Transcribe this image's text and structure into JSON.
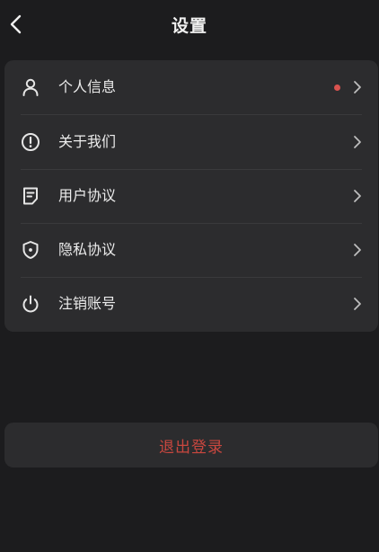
{
  "header": {
    "title": "设置",
    "back_icon": "chevron-left-icon"
  },
  "menu": {
    "items": [
      {
        "label": "个人信息",
        "icon": "user-icon",
        "has_badge_dot": true
      },
      {
        "label": "关于我们",
        "icon": "info-circle-icon",
        "has_badge_dot": false
      },
      {
        "label": "用户协议",
        "icon": "document-icon",
        "has_badge_dot": false
      },
      {
        "label": "隐私协议",
        "icon": "shield-icon",
        "has_badge_dot": false
      },
      {
        "label": "注销账号",
        "icon": "power-icon",
        "has_badge_dot": false
      }
    ]
  },
  "logout": {
    "label": "退出登录"
  },
  "colors": {
    "background": "#1c1c1e",
    "card": "#2c2c2e",
    "text": "#ececec",
    "icon": "#e6e6e6",
    "chevron": "#bdbdbd",
    "badge_dot": "#d9534f",
    "logout_text": "#c9473f"
  }
}
